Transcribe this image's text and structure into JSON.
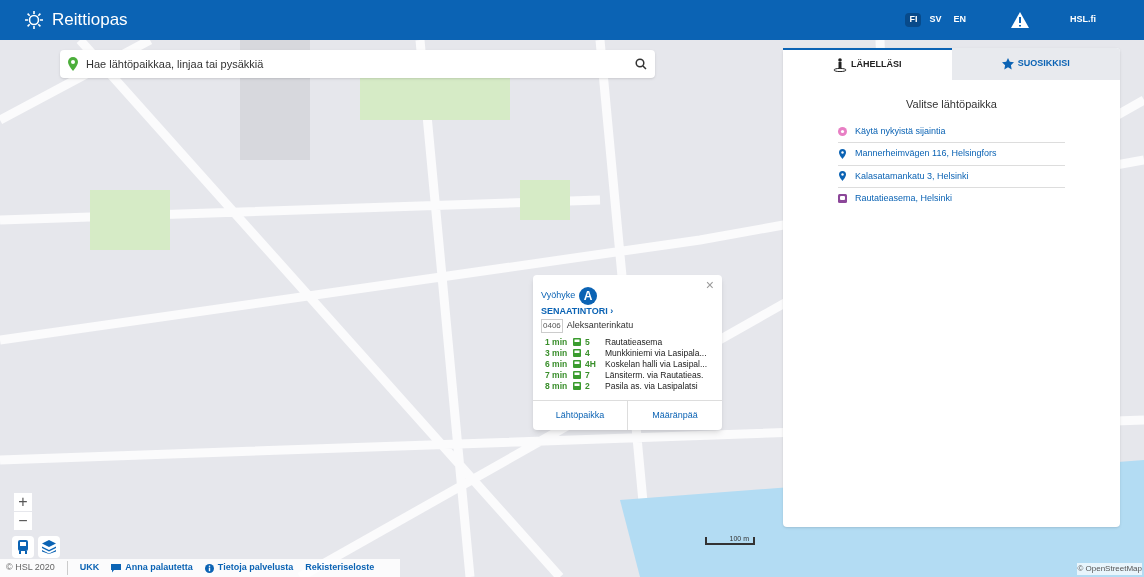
{
  "header": {
    "title": "Reittiopas",
    "languages": [
      {
        "label": "FI",
        "selected": true
      },
      {
        "label": "SV",
        "selected": false
      },
      {
        "label": "EN",
        "selected": false
      }
    ],
    "site_link": "HSL.fi"
  },
  "search": {
    "placeholder": "Hae lähtöpaikkaa, linjaa tai pysäkkiä"
  },
  "panel": {
    "tabs": [
      {
        "label": "LÄHELLÄSI",
        "kind": "nearby",
        "selected": true
      },
      {
        "label": "SUOSIKKISI",
        "kind": "favourites",
        "selected": false
      }
    ],
    "heading": "Valitse lähtöpaikka",
    "items": [
      {
        "kind": "location",
        "label": "Käytä nykyistä sijaintia"
      },
      {
        "kind": "address",
        "label": "Mannerheimvägen 116, Helsingfors"
      },
      {
        "kind": "address",
        "label": "Kalasatamankatu 3, Helsinki"
      },
      {
        "kind": "station",
        "label": "Rautatieasema, Helsinki"
      }
    ]
  },
  "popup": {
    "zone_label": "Vyöhyke",
    "zone": "A",
    "stop_name": "SENAATINTORI ›",
    "stop_code": "0406",
    "street": "Aleksanterinkatu",
    "close": "×",
    "departures": [
      {
        "time": "1 min",
        "route": "5",
        "destination": "Rautatieasema"
      },
      {
        "time": "3 min",
        "route": "4",
        "destination": "Munkkiniemi via Lasipala..."
      },
      {
        "time": "6 min",
        "route": "4H",
        "destination": "Koskelan halli via Lasipal..."
      },
      {
        "time": "7 min",
        "route": "7",
        "destination": "Länsiterm. via Rautatieas."
      },
      {
        "time": "8 min",
        "route": "2",
        "destination": "Pasila as. via Lasipalatsi"
      }
    ],
    "buttons": [
      "Lähtöpaikka",
      "Määränpää"
    ]
  },
  "map_controls": {
    "zoom_in": "+",
    "zoom_out": "−",
    "scale": "100 m",
    "attribution": "© OpenStreetMap"
  },
  "footer": {
    "copyright": "© HSL 2020",
    "links": [
      {
        "kind": "plain",
        "label": "UKK"
      },
      {
        "kind": "feedback",
        "label": "Anna palautetta"
      },
      {
        "kind": "info",
        "label": "Tietoja palvelusta"
      },
      {
        "kind": "plain",
        "label": "Rekisteriseloste"
      }
    ]
  }
}
